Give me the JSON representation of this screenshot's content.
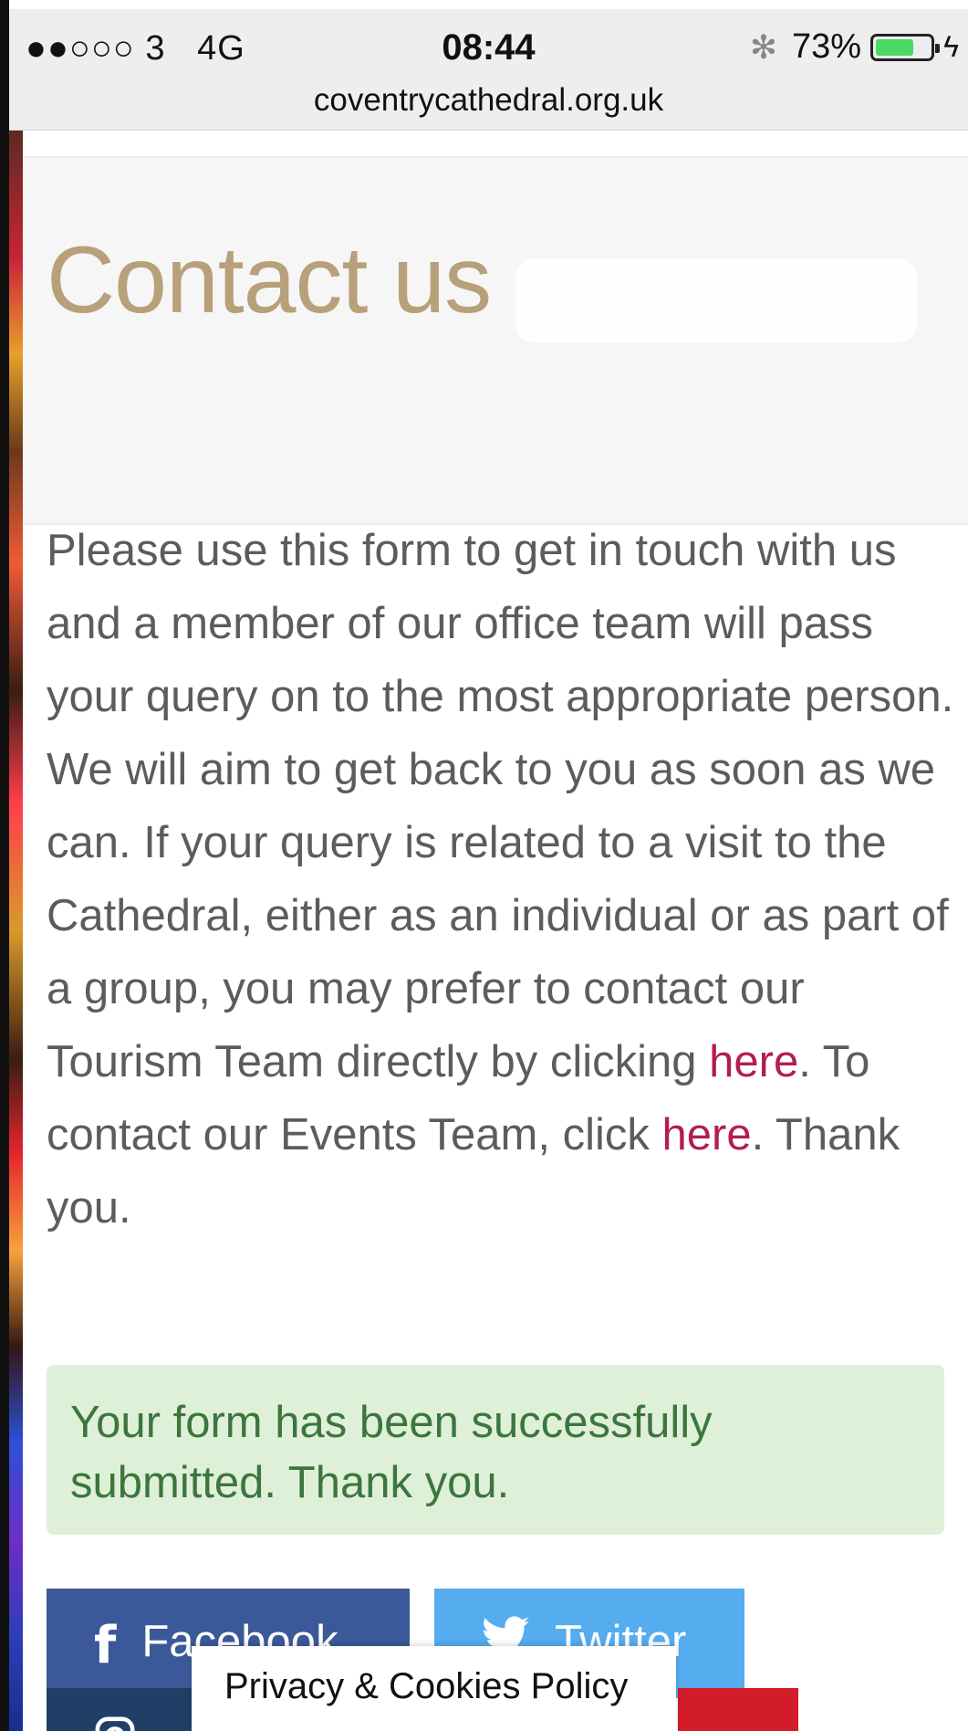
{
  "status_bar": {
    "signal": "●●○○○ 3",
    "network": "4G",
    "time": "08:44",
    "bluetooth_icon": "bluetooth-icon",
    "battery_percent": "73%",
    "battery_level": 0.73,
    "charging_icon": "lightning-icon"
  },
  "browser": {
    "url": "coventrycathedral.org.uk"
  },
  "page": {
    "title": "Contact us",
    "title_color": "#b7a07a",
    "intro_part1": "Please use this form to get in touch with us and a member of our office team will pass your query on to the most appropriate person. We will aim to get back to you as soon as we can. If your query is related to a visit to the Cathedral, either as an individual or as part of a group, you may prefer to contact our Tourism Team directly by clicking ",
    "link1": "here",
    "intro_part2": ". To contact our Events Team, click ",
    "link2": "here",
    "intro_part3": ". Thank you.",
    "link_color": "#b21e4e",
    "success_message": "Your form has been successfully submitted. Thank you.",
    "success_color": "#3c763d"
  },
  "social": {
    "facebook_label": "Facebook",
    "facebook_icon": "facebook-icon",
    "twitter_label": "Twitter",
    "twitter_icon": "twitter-icon",
    "instagram_icon": "instagram-icon",
    "youtube_icon": "youtube-icon"
  },
  "privacy_popup": {
    "label": "Privacy & Cookies Policy"
  }
}
